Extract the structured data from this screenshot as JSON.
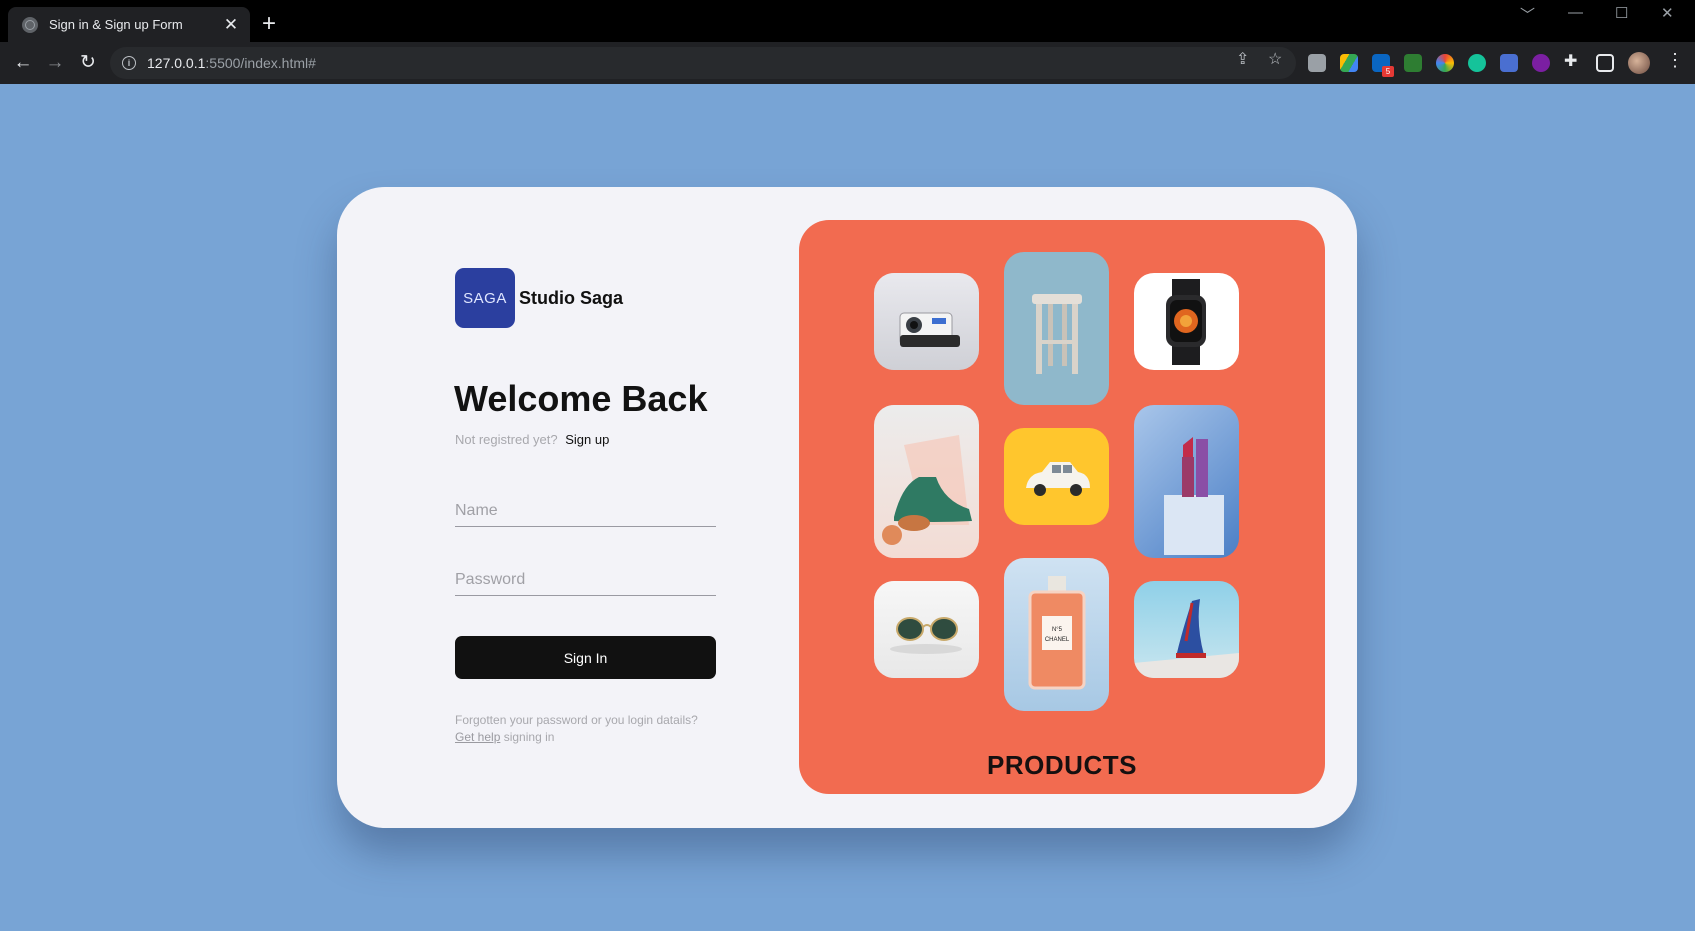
{
  "browser": {
    "tab_title": "Sign in & Sign up Form",
    "tab_close": "✕",
    "new_tab": "+",
    "url_host": "127.0.0.1",
    "url_rest": ":5500/index.html#",
    "window_controls": [
      "﹀",
      "—",
      "☐",
      "✕"
    ]
  },
  "brand": {
    "logo_text": "SAGA",
    "name": "Studio Saga",
    "logo_color": "#2b3f9f"
  },
  "login": {
    "heading": "Welcome Back",
    "not_registered": "Not registred yet?",
    "signup_link": "Sign up",
    "name_placeholder": "Name",
    "password_placeholder": "Password",
    "signin_label": "Sign In",
    "help_line1": "Forgotten your password or you login datails?",
    "help_link": "Get help",
    "help_rest": "signing in"
  },
  "products": {
    "title": "PRODUCTS",
    "panel_color": "#f26b50",
    "items": [
      {
        "name": "camera"
      },
      {
        "name": "stool"
      },
      {
        "name": "smartwatch"
      },
      {
        "name": "shoe"
      },
      {
        "name": "toy-car"
      },
      {
        "name": "lipstick"
      },
      {
        "name": "sunglasses"
      },
      {
        "name": "perfume"
      },
      {
        "name": "high-heel"
      }
    ]
  },
  "colors": {
    "page_background": "#78a4d5",
    "card_background": "#f3f3f8",
    "button": "#111111"
  }
}
